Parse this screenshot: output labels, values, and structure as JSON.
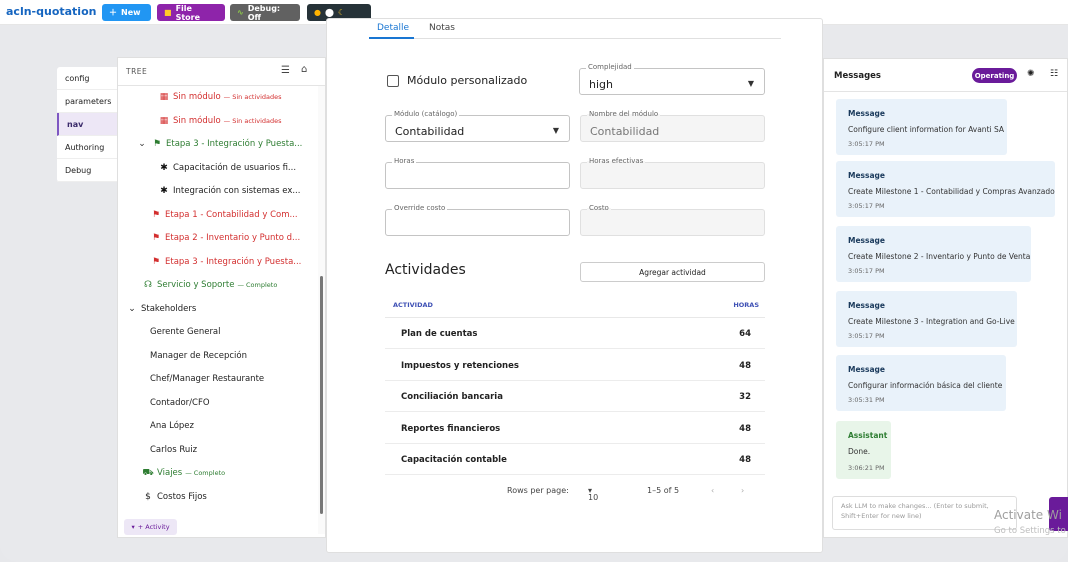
{
  "app": {
    "title": "acln-quotation"
  },
  "toolbar": {
    "new": "New",
    "filestore": "File Store",
    "debug": "Debug: Off"
  },
  "side_tabs": [
    "config",
    "parameters",
    "nav",
    "Authoring",
    "Debug"
  ],
  "tree": {
    "title": "TREE",
    "add_activity": "+ Activity",
    "rows": [
      {
        "label": "Sin módulo",
        "sub": "— Sin actividades",
        "color": "red",
        "icon": "grid"
      },
      {
        "label": "Sin módulo",
        "sub": "— Sin actividades",
        "color": "red",
        "icon": "grid"
      },
      {
        "label": "Etapa 3 - Integración y Puesta...",
        "sub": "",
        "color": "green",
        "icon": "flag"
      },
      {
        "label": "Capacitación de usuarios fi...",
        "sub": "",
        "color": "gray",
        "icon": "puzzle"
      },
      {
        "label": "Integración con sistemas ex...",
        "sub": "",
        "color": "gray",
        "icon": "puzzle"
      },
      {
        "label": "Etapa 1 - Contabilidad y Com...",
        "sub": "",
        "color": "red",
        "icon": "flag"
      },
      {
        "label": "Etapa 2 - Inventario y Punto d...",
        "sub": "",
        "color": "red",
        "icon": "flag"
      },
      {
        "label": "Etapa 3 - Integración y Puesta...",
        "sub": "",
        "color": "red",
        "icon": "flag"
      },
      {
        "label": "Servicio y Soporte",
        "sub": "— Completo",
        "color": "green",
        "icon": "headset"
      },
      {
        "label": "Stakeholders",
        "sub": "",
        "color": "gray",
        "icon": "chevron"
      },
      {
        "label": "Gerente General",
        "sub": "",
        "color": "gray",
        "icon": ""
      },
      {
        "label": "Manager de Recepción",
        "sub": "",
        "color": "gray",
        "icon": ""
      },
      {
        "label": "Chef/Manager Restaurante",
        "sub": "",
        "color": "gray",
        "icon": ""
      },
      {
        "label": "Contador/CFO",
        "sub": "",
        "color": "gray",
        "icon": ""
      },
      {
        "label": "Ana López",
        "sub": "",
        "color": "gray",
        "icon": ""
      },
      {
        "label": "Carlos Ruiz",
        "sub": "",
        "color": "gray",
        "icon": ""
      },
      {
        "label": "Viajes",
        "sub": "— Completo",
        "color": "green",
        "icon": "car"
      },
      {
        "label": "Costos Fijos",
        "sub": "",
        "color": "gray",
        "icon": "dollar"
      }
    ]
  },
  "detail": {
    "tabs": [
      "Detalle",
      "Notas"
    ],
    "checkbox_label": "Módulo personalizado",
    "fields": {
      "complejidad": {
        "label": "Complejidad",
        "value": "high"
      },
      "modulo_catalogo": {
        "label": "Módulo (catálogo)",
        "value": "Contabilidad"
      },
      "nombre_modulo": {
        "label": "Nombre del módulo",
        "value": "Contabilidad"
      },
      "horas": {
        "label": "Horas",
        "value": ""
      },
      "horas_efectivas": {
        "label": "Horas efectivas",
        "value": ""
      },
      "override_costo": {
        "label": "Override costo",
        "value": ""
      },
      "costo": {
        "label": "Costo",
        "value": ""
      }
    },
    "activities_title": "Actividades",
    "add_activity": "Agregar actividad",
    "table": {
      "headers": [
        "ACTIVIDAD",
        "HORAS"
      ],
      "rows": [
        {
          "name": "Plan de cuentas",
          "hours": "64"
        },
        {
          "name": "Impuestos y retenciones",
          "hours": "48"
        },
        {
          "name": "Conciliación bancaria",
          "hours": "32"
        },
        {
          "name": "Reportes financieros",
          "hours": "48"
        },
        {
          "name": "Capacitación contable",
          "hours": "48"
        }
      ]
    },
    "pager": {
      "rows_per_page": "Rows per page:",
      "rows_value": "10",
      "range": "1–5 of 5"
    }
  },
  "messages": {
    "title": "Messages",
    "status": "Operating",
    "items": [
      {
        "type": "Message",
        "body": "Configure client information for Avanti SA",
        "time": "3:05:17 PM"
      },
      {
        "type": "Message",
        "body": "Create Milestone 1 - Contabilidad y Compras Avanzado",
        "time": "3:05:17 PM"
      },
      {
        "type": "Message",
        "body": "Create Milestone 2 - Inventario y Punto de Venta",
        "time": "3:05:17 PM"
      },
      {
        "type": "Message",
        "body": "Create Milestone 3 - Integration and Go-Live",
        "time": "3:05:17 PM"
      },
      {
        "type": "Message",
        "body": "Configurar información básica del cliente",
        "time": "3:05:31 PM"
      },
      {
        "type": "Assistant",
        "body": "Done.",
        "time": "3:06:21 PM"
      }
    ],
    "input_placeholder": "Ask LLM to make changes... (Enter to submit, Shift+Enter for new line)"
  },
  "watermark": {
    "line1": "Activate Wi",
    "line2": "Go to Settings to"
  }
}
